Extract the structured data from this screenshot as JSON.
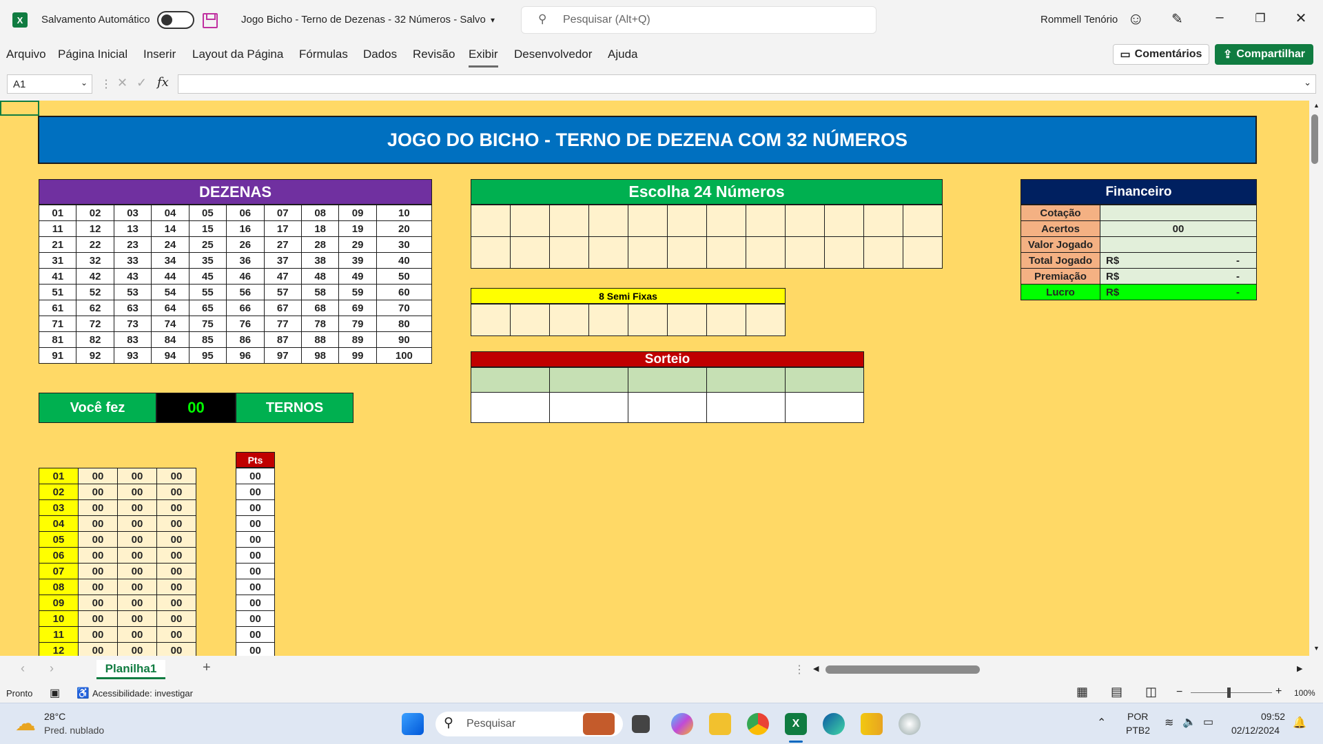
{
  "titlebar": {
    "autosave_label": "Salvamento Automático",
    "doc_title": "Jogo Bicho - Terno de Dezenas - 32 Números  -  Salvo",
    "search_placeholder": "Pesquisar (Alt+Q)",
    "user_name": "Rommell Tenório"
  },
  "ribbon": {
    "tabs": [
      "Arquivo",
      "Página Inicial",
      "Inserir",
      "Layout da Página",
      "Fórmulas",
      "Dados",
      "Revisão",
      "Exibir",
      "Desenvolvedor",
      "Ajuda"
    ],
    "active_tab": "Exibir",
    "comments_label": "Comentários",
    "share_label": "Compartilhar"
  },
  "formula_bar": {
    "name_box": "A1",
    "formula": ""
  },
  "sheet": {
    "banner": "JOGO DO BICHO - TERNO DE DEZENA COM 32 NÚMEROS",
    "dezenas_title": "DEZENAS",
    "dezenas": [
      [
        "01",
        "02",
        "03",
        "04",
        "05",
        "06",
        "07",
        "08",
        "09",
        "10"
      ],
      [
        "11",
        "12",
        "13",
        "14",
        "15",
        "16",
        "17",
        "18",
        "19",
        "20"
      ],
      [
        "21",
        "22",
        "23",
        "24",
        "25",
        "26",
        "27",
        "28",
        "29",
        "30"
      ],
      [
        "31",
        "32",
        "33",
        "34",
        "35",
        "36",
        "37",
        "38",
        "39",
        "40"
      ],
      [
        "41",
        "42",
        "43",
        "44",
        "45",
        "46",
        "47",
        "48",
        "49",
        "50"
      ],
      [
        "51",
        "52",
        "53",
        "54",
        "55",
        "56",
        "57",
        "58",
        "59",
        "60"
      ],
      [
        "61",
        "62",
        "63",
        "64",
        "65",
        "66",
        "67",
        "68",
        "69",
        "70"
      ],
      [
        "71",
        "72",
        "73",
        "74",
        "75",
        "76",
        "77",
        "78",
        "79",
        "80"
      ],
      [
        "81",
        "82",
        "83",
        "84",
        "85",
        "86",
        "87",
        "88",
        "89",
        "90"
      ],
      [
        "91",
        "92",
        "93",
        "94",
        "95",
        "96",
        "97",
        "98",
        "99",
        "100"
      ]
    ],
    "escolha_title": "Escolha 24 Números",
    "semi_fixas_title": "8 Semi Fixas",
    "sorteio_title": "Sorteio",
    "financeiro": {
      "title": "Financeiro",
      "rows": [
        {
          "label": "Cotação",
          "prefix": "",
          "value": ""
        },
        {
          "label": "Acertos",
          "prefix": "",
          "value": "00"
        },
        {
          "label": "Valor Jogado",
          "prefix": "",
          "value": ""
        },
        {
          "label": "Total Jogado",
          "prefix": "R$",
          "value": "-"
        },
        {
          "label": "Premiação",
          "prefix": "R$",
          "value": "-"
        },
        {
          "label": "Lucro",
          "prefix": "R$",
          "value": "-"
        }
      ]
    },
    "voce_fez": {
      "label": "Você fez",
      "value": "00",
      "suffix": "TERNOS"
    },
    "pts_header": "Pts",
    "ternos": [
      {
        "n": "01",
        "a": "00",
        "b": "00",
        "c": "00",
        "pts": "00"
      },
      {
        "n": "02",
        "a": "00",
        "b": "00",
        "c": "00",
        "pts": "00"
      },
      {
        "n": "03",
        "a": "00",
        "b": "00",
        "c": "00",
        "pts": "00"
      },
      {
        "n": "04",
        "a": "00",
        "b": "00",
        "c": "00",
        "pts": "00"
      },
      {
        "n": "05",
        "a": "00",
        "b": "00",
        "c": "00",
        "pts": "00"
      },
      {
        "n": "06",
        "a": "00",
        "b": "00",
        "c": "00",
        "pts": "00"
      },
      {
        "n": "07",
        "a": "00",
        "b": "00",
        "c": "00",
        "pts": "00"
      },
      {
        "n": "08",
        "a": "00",
        "b": "00",
        "c": "00",
        "pts": "00"
      },
      {
        "n": "09",
        "a": "00",
        "b": "00",
        "c": "00",
        "pts": "00"
      },
      {
        "n": "10",
        "a": "00",
        "b": "00",
        "c": "00",
        "pts": "00"
      },
      {
        "n": "11",
        "a": "00",
        "b": "00",
        "c": "00",
        "pts": "00"
      },
      {
        "n": "12",
        "a": "00",
        "b": "00",
        "c": "00",
        "pts": "00"
      }
    ]
  },
  "sheet_tabs": {
    "active": "Planilha1"
  },
  "status_bar": {
    "ready": "Pronto",
    "accessibility": "Acessibilidade: investigar",
    "zoom": "100%"
  },
  "taskbar": {
    "weather_temp": "28°C",
    "weather_desc": "Pred. nublado",
    "search_placeholder": "Pesquisar",
    "lang": "POR",
    "layout": "PTB2",
    "time": "09:52",
    "date": "02/12/2024"
  },
  "colors": {
    "sheet_bg": "#ffd966",
    "banner": "#0070c0",
    "dezenas_header": "#7030a0",
    "escolha_header": "#00b050",
    "sorteio_header": "#c00000",
    "financeiro_header": "#002060",
    "excel_green": "#107c41"
  }
}
